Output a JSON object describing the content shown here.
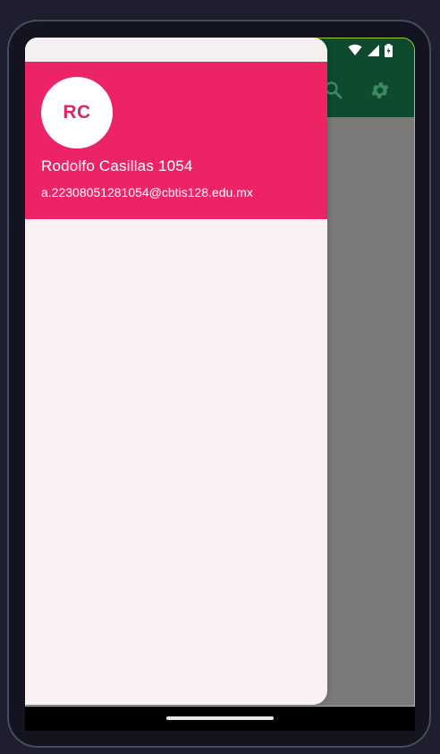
{
  "app": {
    "appbar_color": "#0d4a2e",
    "accent": "#ec2465",
    "actions": [
      {
        "icon": "search-icon"
      },
      {
        "icon": "gear-icon"
      }
    ]
  },
  "status_bar": {
    "icons": [
      "wifi-icon",
      "signal-icon",
      "battery-icon"
    ]
  },
  "drawer": {
    "header": {
      "avatar_initials": "RC",
      "user_name": "Rodolfo Casillas 1054",
      "user_email": "a.22308051281054@cbtis128.edu.mx"
    }
  }
}
